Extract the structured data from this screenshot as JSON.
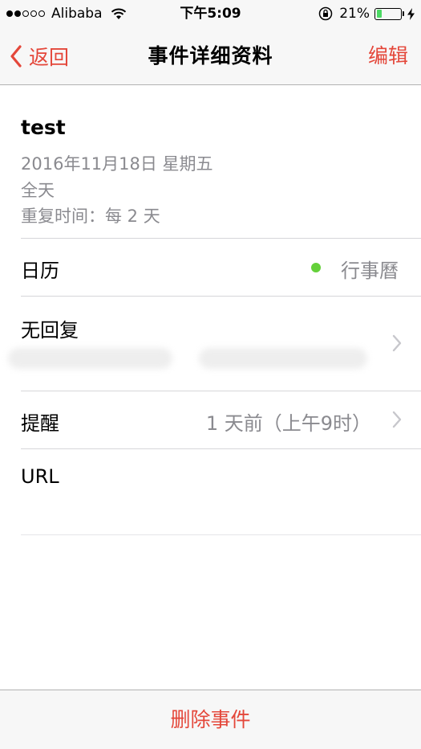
{
  "status_bar": {
    "carrier": "Alibaba",
    "time": "下午5:09",
    "battery_percent": "21%",
    "battery_level": 0.21,
    "signal_bars": 2,
    "signal_total": 5
  },
  "nav": {
    "back_label": "返回",
    "title": "事件详细资料",
    "edit_label": "编辑"
  },
  "event": {
    "title": "test",
    "date": "2016年11月18日 星期五",
    "all_day": "全天",
    "repeat": "重复时间：每 2 天"
  },
  "rows": {
    "calendar": {
      "label": "日历",
      "value": "行事曆",
      "dot_color": "#64d03a"
    },
    "no_reply": {
      "label": "无回复"
    },
    "alert": {
      "label": "提醒",
      "value": "1 天前（上午9时）"
    },
    "url": {
      "label": "URL"
    }
  },
  "footer": {
    "delete_label": "删除事件"
  },
  "colors": {
    "accent": "#e4473a",
    "secondary_text": "#8a8a8f",
    "separator": "#d6d6d9",
    "bar_background": "#f7f7f7"
  },
  "icons": [
    "signal-dots-icon",
    "wifi-icon",
    "rotation-lock-icon",
    "battery-icon",
    "charging-bolt-icon",
    "back-chevron-icon",
    "chevron-right-icon"
  ]
}
